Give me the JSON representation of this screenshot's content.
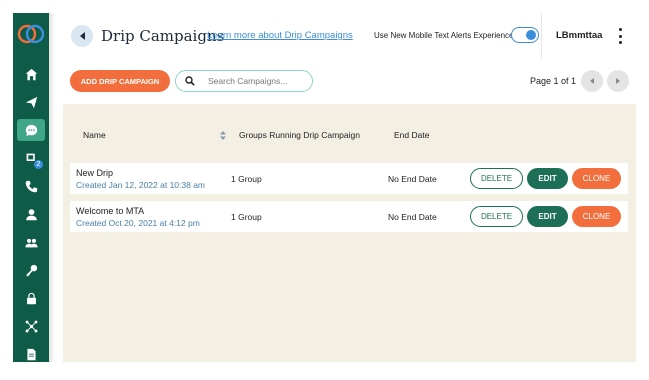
{
  "sidebar": {
    "icons": [
      "home-icon",
      "send-icon",
      "chat-icon",
      "mobile-message-icon",
      "phone-icon",
      "user-icon",
      "group-icon",
      "key-icon",
      "lock-icon",
      "network-icon",
      "document-icon"
    ],
    "active_index": 2,
    "badge_count": "2"
  },
  "header": {
    "title": "Drip Campaigns",
    "learn_link": "Learn more about Drip Campaigns",
    "toggle_label": "Use New Mobile Text Alerts Experience",
    "toggle_on": true,
    "user_name": "LBmmttaa"
  },
  "toolbar": {
    "add_label": "ADD DRIP CAMPAIGN",
    "search_placeholder": "Search Campaigns...",
    "page_info": "Page 1 of 1"
  },
  "table": {
    "headers": {
      "name": "Name",
      "groups": "Groups Running Drip Campaign",
      "end_date": "End Date"
    },
    "rows": [
      {
        "name": "New Drip",
        "created": "Created Jan 12, 2022 at 10:38 am",
        "groups": "1 Group",
        "end_date": "No End Date"
      },
      {
        "name": "Welcome to MTA",
        "created": "Created Oct 20, 2021 at 4:12 pm",
        "groups": "1 Group",
        "end_date": "No End Date"
      }
    ],
    "actions": {
      "delete": "DELETE",
      "edit": "EDIT",
      "clone": "CLONE"
    }
  },
  "colors": {
    "sidebar": "#0e5b47",
    "active": "#3fa686",
    "accent_orange": "#f26e3d",
    "accent_green": "#1d6f55",
    "link_blue": "#3b8ede",
    "content_bg": "#f3efe3"
  }
}
